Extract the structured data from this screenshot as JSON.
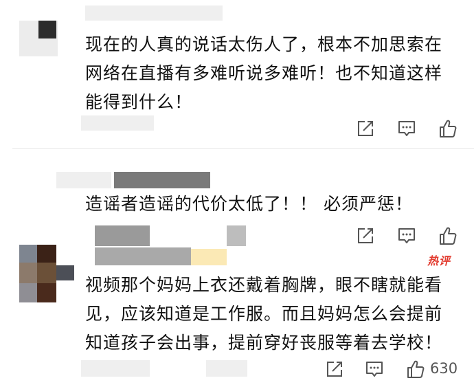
{
  "comments": [
    {
      "text": "现在的人真的说话太伤人了，根本不加思索在\n网络在直播有多难听说多难听！也不知道这样\n能得到什么！"
    },
    {
      "text": "造谣者造谣的代价太低了！！ 必须严惩！"
    },
    {
      "badge": "热评",
      "text": "视频那个妈妈上衣还戴着胸牌，眼不瞎就能看\n见，应该知道是工作服。而且妈妈怎么会提前\n知道孩子会出事，提前穿好丧服等着去学校！",
      "likes": "630"
    }
  ],
  "icons": [
    "share-icon",
    "comment-icon",
    "like-icon"
  ],
  "colors": {
    "hot_badge": "#e23a2e",
    "icon": "#555555"
  }
}
